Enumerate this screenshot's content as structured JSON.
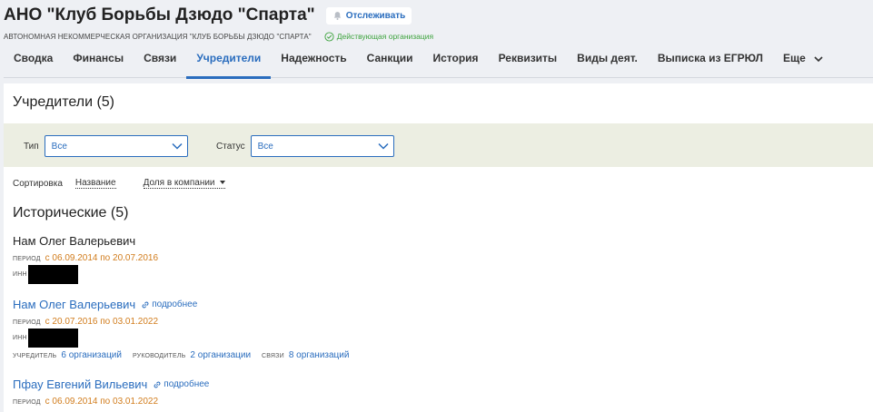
{
  "header": {
    "title": "АНО \"Клуб Борьбы Дзюдо \"Спарта\"",
    "follow_label": "Отслеживать",
    "full_name": "АВТОНОМНАЯ НЕКОММЕРЧЕСКАЯ ОРГАНИЗАЦИЯ \"КЛУБ БОРЬБЫ ДЗЮДО \"СПАРТА\"",
    "status": "Действующая организация",
    "status_color": "#3ea33e"
  },
  "tabs": [
    {
      "label": "Сводка"
    },
    {
      "label": "Финансы"
    },
    {
      "label": "Связи"
    },
    {
      "label": "Учредители",
      "active": true
    },
    {
      "label": "Надежность"
    },
    {
      "label": "Санкции"
    },
    {
      "label": "История"
    },
    {
      "label": "Реквизиты"
    },
    {
      "label": "Виды деят."
    },
    {
      "label": "Выписка из ЕГРЮЛ"
    },
    {
      "label": "Еще"
    }
  ],
  "main": {
    "section_title": "Учредители (5)",
    "filters": {
      "type_label": "Тип",
      "type_value": "Все",
      "status_label": "Статус",
      "status_value": "Все"
    },
    "sort": {
      "label": "Сортировка",
      "option1": "Название",
      "option2": "Доля в компании"
    },
    "historical_title": "Исторические (5)",
    "persons": [
      {
        "name": "Нам Олег Валерьевич",
        "period_label": "период",
        "period": "с 06.09.2014 по 20.07.2016",
        "inn_label": "инн"
      },
      {
        "name": "Нам Олег Валерьевич",
        "more": "подробнее",
        "period_label": "период",
        "period": "с 20.07.2016 по 03.01.2022",
        "inn_label": "инн",
        "founder_label": "учредитель",
        "founder_value": "6 организаций",
        "manager_label": "руководитель",
        "manager_value": "2 организации",
        "links_label": "связи",
        "links_value": "8 организаций"
      },
      {
        "name": "Пфау Евгений Вильевич",
        "more": "подробнее",
        "period_label": "период",
        "period": "с 06.09.2014 по 03.01.2022"
      }
    ]
  },
  "colors": {
    "accent": "#2a6dbe",
    "period": "#d17c1c",
    "filter_bg": "#eceee2"
  }
}
